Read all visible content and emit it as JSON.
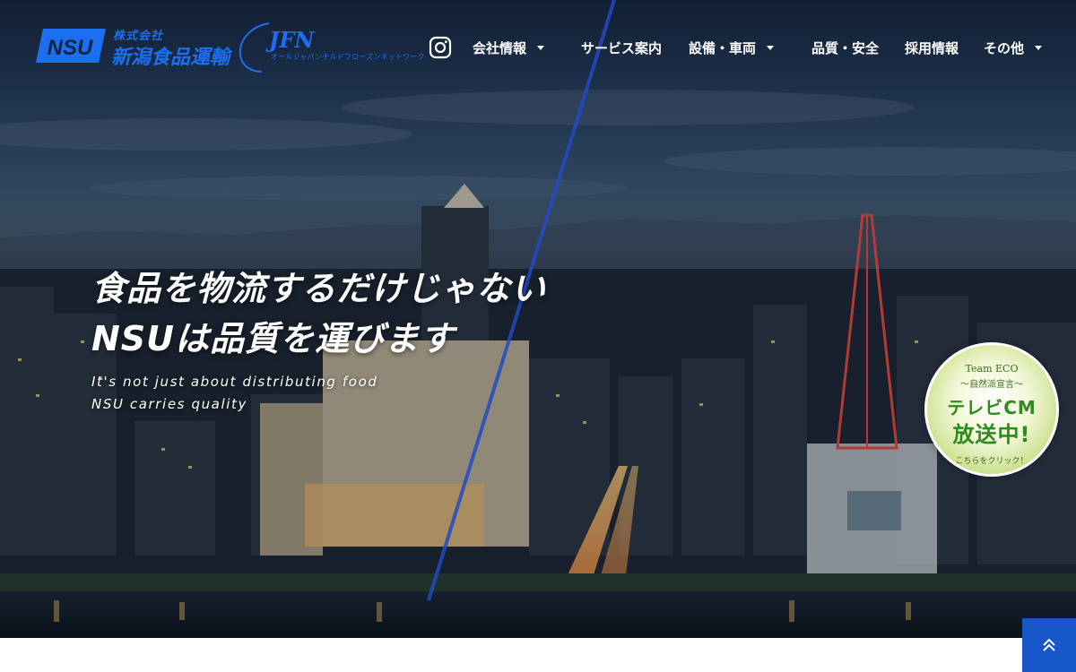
{
  "header": {
    "logo_mark_text": "NSU",
    "company_type": "株式会社",
    "company_name": "新潟食品運輸",
    "partner_logo": "JFN",
    "partner_sub": "オールジャパンチルドフローズンネットワーク"
  },
  "nav": {
    "instagram_icon": "instagram-icon",
    "items": [
      {
        "label": "会社情報",
        "has_dropdown": true
      },
      {
        "label": "サービス案内",
        "has_dropdown": false
      },
      {
        "label": "設備・車両",
        "has_dropdown": true
      },
      {
        "label": "品質・安全",
        "has_dropdown": false
      },
      {
        "label": "採用情報",
        "has_dropdown": false
      },
      {
        "label": "その他",
        "has_dropdown": true
      }
    ]
  },
  "hero": {
    "headline_1": "食品を物流するだけじゃない",
    "headline_2": "NSUは品質を運びます",
    "subline_1": "It's not just about distributing food",
    "subline_2": "NSU carries quality"
  },
  "eco_banner": {
    "line1": "Team ECO",
    "line2": "〜自然派宣言〜",
    "line3": "テレビCM",
    "line4": "放送中!",
    "line5": "こちらをクリック！"
  },
  "scroll_top": {
    "icon": "double-chevron-up-icon"
  },
  "colors": {
    "brand_blue": "#1b6ff0",
    "scroll_button": "#1656c9",
    "eco_green": "#2e8b1e"
  }
}
